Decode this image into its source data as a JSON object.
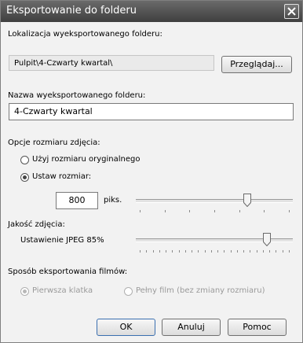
{
  "window": {
    "title": "Eksportowanie do folderu"
  },
  "location": {
    "label": "Lokalizacja wyeksportowanego folderu:",
    "value": "Pulpit\\4-Czwarty kwartal\\",
    "browse_button": "Przeglądaj..."
  },
  "folder_name": {
    "label": "Nazwa wyeksportowanego folderu:",
    "value": "4-Czwarty kwartal"
  },
  "size_options": {
    "label": "Opcje rozmiaru zdjęcia:",
    "original_option": "Użyj rozmiaru oryginalnego",
    "resize_option": "Ustaw rozmiar:",
    "selected": "resize",
    "size_value": "800",
    "unit": "piks.",
    "slider_level": 0.72
  },
  "quality": {
    "label": "Jakość zdjęcia:",
    "setting": "Ustawienie JPEG 85%",
    "slider_level": 0.85
  },
  "video_export": {
    "label": "Sposób eksportowania filmów:",
    "first_frame_option": "Pierwsza klatka",
    "full_video_option": "Pełny film (bez zmiany rozmiaru)"
  },
  "buttons": {
    "ok": "OK",
    "cancel": "Anuluj",
    "help": "Pomoc"
  }
}
